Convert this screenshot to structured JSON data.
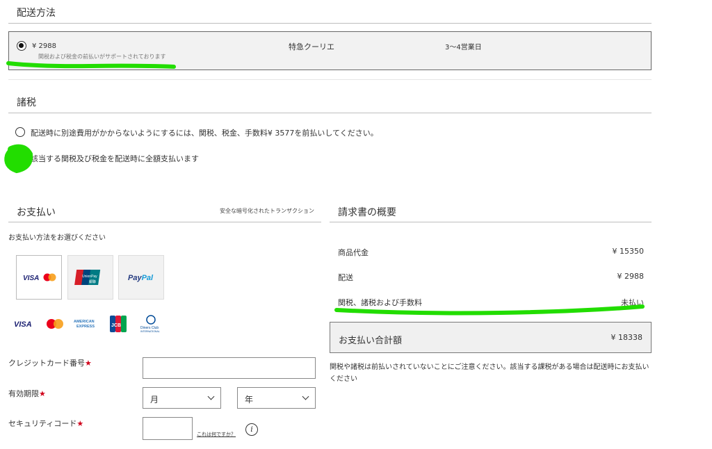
{
  "shipping": {
    "title": "配送方法",
    "option": {
      "price": "¥ 2988",
      "note": "関税および税金の前払いがサポートされております",
      "carrier": "特急クーリエ",
      "eta": "3〜4営業日"
    }
  },
  "duties": {
    "title": "諸税",
    "options": [
      {
        "label": "配送時に別途費用がかからないようにするには、関税、税金、手数料¥ 3577を前払いしてください。",
        "selected": false
      },
      {
        "label": "該当する関税及び税金を配送時に全額支払います",
        "selected": true
      }
    ]
  },
  "payment": {
    "title": "お支払い",
    "secure_note": "安全な暗号化されたトランザクション",
    "choose_label": "お支払い方法をお選びください",
    "methods": [
      {
        "name": "visa-mastercard",
        "selected": true
      },
      {
        "name": "unionpay",
        "text": "UnionPay 銀聯",
        "selected": false
      },
      {
        "name": "paypal",
        "text": "PayPal",
        "selected": false
      }
    ],
    "card_logos": {
      "visa": "VISA",
      "mastercard": "MasterCard",
      "amex": "AMERICAN EXPRESS",
      "jcb": "JCB",
      "diners": "Diners Club"
    },
    "card_number_label": "クレジットカード番号",
    "expiry_label": "有効期限",
    "month_placeholder": "月",
    "year_placeholder": "年",
    "security_code_label": "セキュリティコード",
    "help_link": "これは何ですか？",
    "required_mark": "★"
  },
  "summary": {
    "title": "請求書の概要",
    "rows": [
      {
        "label": "商品代金",
        "value": "¥ 15350"
      },
      {
        "label": "配送",
        "value": "¥ 2988"
      },
      {
        "label": "関税、諸税および手数料",
        "value": "未払い"
      }
    ],
    "total_label": "お支払い合計額",
    "total_value": "¥ 18338",
    "notice": "関税や諸税は前払いされていないことにご注意ください。該当する課税がある場合は配送時にお支払いください"
  },
  "colors": {
    "highlight": "#22dd00",
    "required": "#d0021b",
    "panel": "#f2f2f2"
  }
}
